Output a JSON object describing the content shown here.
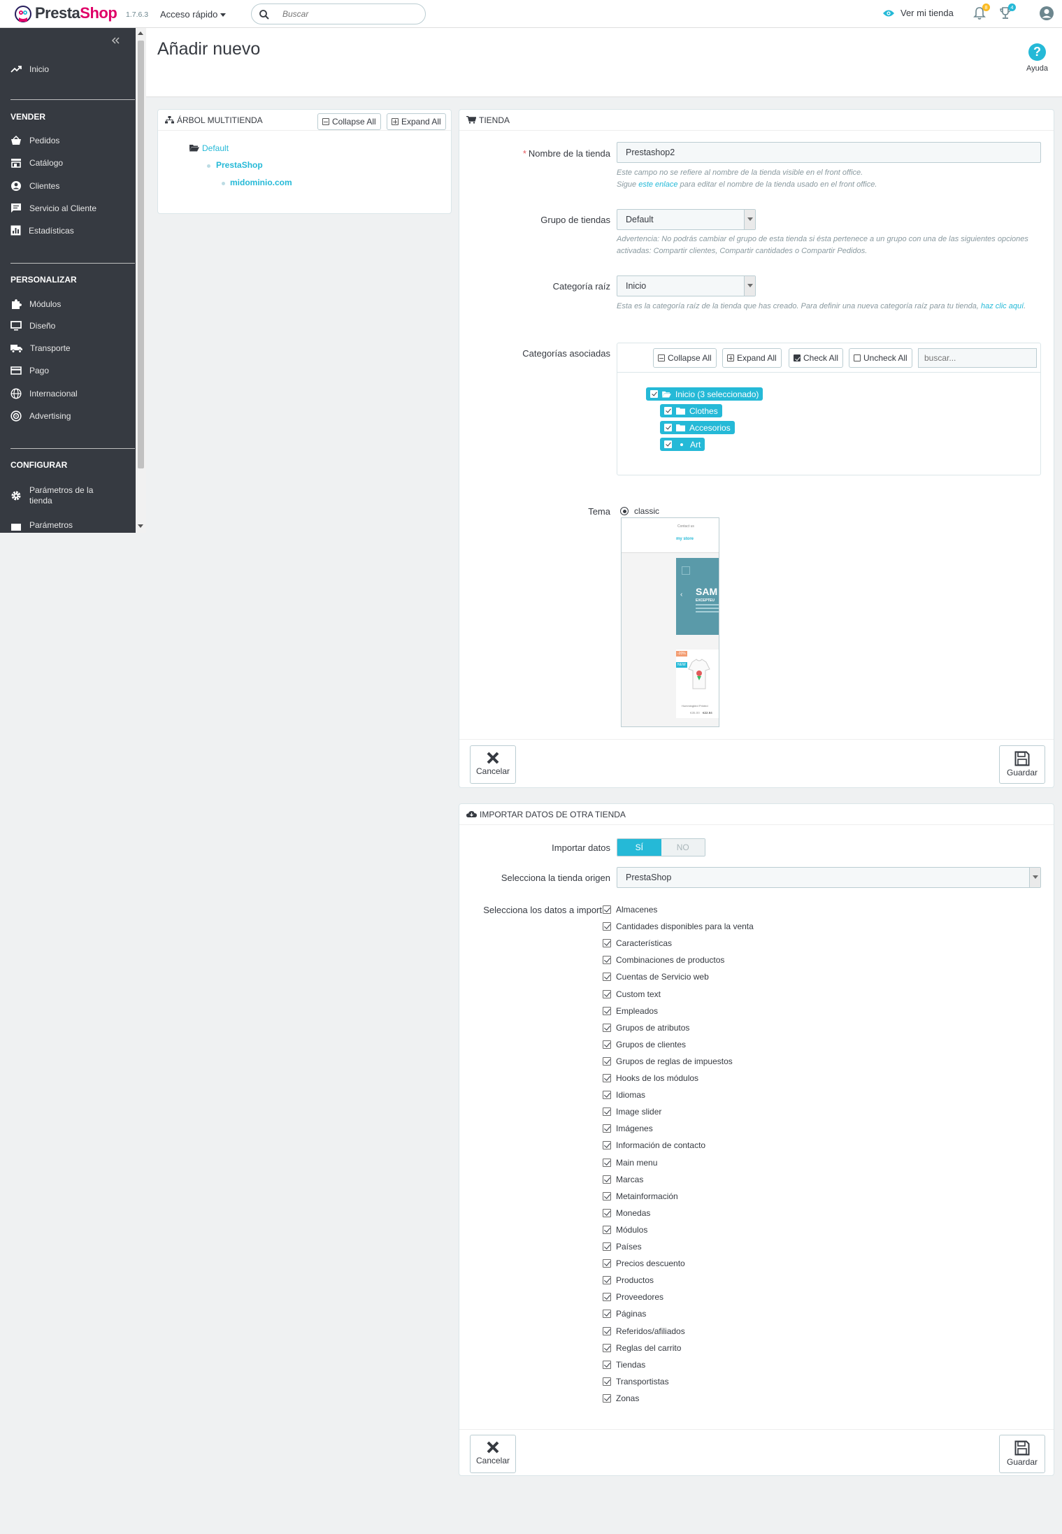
{
  "header": {
    "logo_presta": "Presta",
    "logo_shop": "Shop",
    "version": "1.7.6.3",
    "quick_access": "Acceso rápido",
    "search_placeholder": "Buscar",
    "view_store": "Ver mi tienda",
    "notifications_count": "8",
    "orders_count": "4",
    "accent": "#25b9d7",
    "brand_pink": "#df0067"
  },
  "sidebar": {
    "home": "Inicio",
    "sections": [
      {
        "title": "VENDER",
        "items": [
          "Pedidos",
          "Catálogo",
          "Clientes",
          "Servicio al Cliente",
          "Estadísticas"
        ]
      },
      {
        "title": "PERSONALIZAR",
        "items": [
          "Módulos",
          "Diseño",
          "Transporte",
          "Pago",
          "Internacional",
          "Advertising"
        ]
      },
      {
        "title": "CONFIGURAR",
        "items": [
          "Parámetros de la tienda",
          "Parámetros"
        ]
      }
    ]
  },
  "page": {
    "title": "Añadir nuevo",
    "help": "Ayuda"
  },
  "tree_panel": {
    "title": "ÁRBOL MULTITIENDA",
    "collapse_all": "Collapse All",
    "expand_all": "Expand All",
    "group": "Default",
    "shop": "PrestaShop",
    "url": "midominio.com"
  },
  "shop_panel": {
    "title": "TIENDA",
    "name_label": "Nombre de la tienda",
    "name_value": "Prestashop2",
    "name_help_1": "Este campo no se refiere al nombre de la tienda visible en el front office.",
    "name_help_2a": "Sigue ",
    "name_help_link": "este enlace",
    "name_help_2b": " para editar el nombre de la tienda usado en el front office.",
    "group_label": "Grupo de tiendas",
    "group_value": "Default",
    "group_help": "Advertencia: No podrás cambiar el grupo de esta tienda si ésta pertenece a un grupo con una de las siguientes opciones activadas: Compartir clientes, Compartir cantidades o Compartir Pedidos.",
    "root_label": "Categoría raíz",
    "root_value": "Inicio",
    "root_help": "Esta es la categoría raíz de la tienda que has creado. Para definir una nueva categoría raíz para tu tienda, ",
    "root_help_link": "haz clic aquí",
    "root_help_end": ".",
    "assoc_label": "Categorías asociadas",
    "collapse_all": "Collapse All",
    "expand_all": "Expand All",
    "check_all": "Check All",
    "uncheck_all": "Uncheck All",
    "tree_search_placeholder": "buscar...",
    "root_node": "Inicio (3 seleccionado)",
    "child_nodes": [
      "Clothes",
      "Accesorios",
      "Art"
    ],
    "theme_label": "Tema",
    "theme_value": "classic",
    "theme_preview": {
      "contact": "Contact us",
      "store": "my store",
      "banner_title": "SAM",
      "banner_sub": "EXCEPTEU",
      "sale": "-20%",
      "new": "NEW",
      "product": "Hummingbird Printed",
      "old_price": "€35.00",
      "price": "€22.94"
    },
    "cancel": "Cancelar",
    "save": "Guardar"
  },
  "import_panel": {
    "title": "IMPORTAR DATOS DE OTRA TIENDA",
    "import_label": "Importar datos",
    "yes": "SÍ",
    "no": "NO",
    "source_label": "Selecciona la tienda origen",
    "source_value": "PrestaShop",
    "data_label": "Selecciona los datos a import",
    "items": [
      "Almacenes",
      "Cantidades disponibles para la venta",
      "Características",
      "Combinaciones de productos",
      "Cuentas de Servicio web",
      "Custom text",
      "Empleados",
      "Grupos de atributos",
      "Grupos de clientes",
      "Grupos de reglas de impuestos",
      "Hooks de los módulos",
      "Idiomas",
      "Image slider",
      "Imágenes",
      "Información de contacto",
      "Main menu",
      "Marcas",
      "Metainformación",
      "Monedas",
      "Módulos",
      "Países",
      "Precios descuento",
      "Productos",
      "Proveedores",
      "Páginas",
      "Referidos/afiliados",
      "Reglas del carrito",
      "Tiendas",
      "Transportistas",
      "Zonas"
    ],
    "cancel": "Cancelar",
    "save": "Guardar"
  }
}
